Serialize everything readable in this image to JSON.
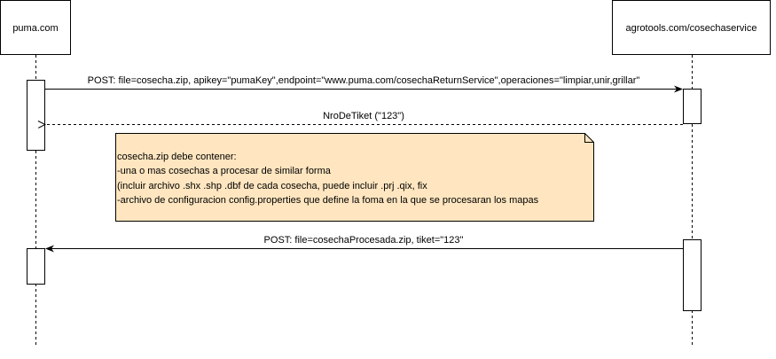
{
  "participants": {
    "left": "puma.com",
    "right": "agrotools.com/cosechaservice"
  },
  "messages": {
    "request": "POST: file=cosecha.zip, apikey=\"pumaKey\",endpoint=\"www.puma.com/cosechaReturnService\",operaciones=\"limpiar,unir,grillar\"",
    "response": "NroDeTiket (\"123\")",
    "callback": "POST: file=cosechaProcesada.zip, tiket=\"123\""
  },
  "note": {
    "lines": [
      "cosecha.zip debe contener:",
      "-una o mas cosechas a procesar de similar forma",
      "(incluir archivo .shx .shp .dbf de cada cosecha, puede incluir .prj .qix, fix",
      "-archivo de configuracion config.properties que define la foma en la que se procesaran los mapas"
    ]
  },
  "colors": {
    "note_fill": "#ffe6c0",
    "line": "#000000",
    "background": "#ffffff"
  }
}
